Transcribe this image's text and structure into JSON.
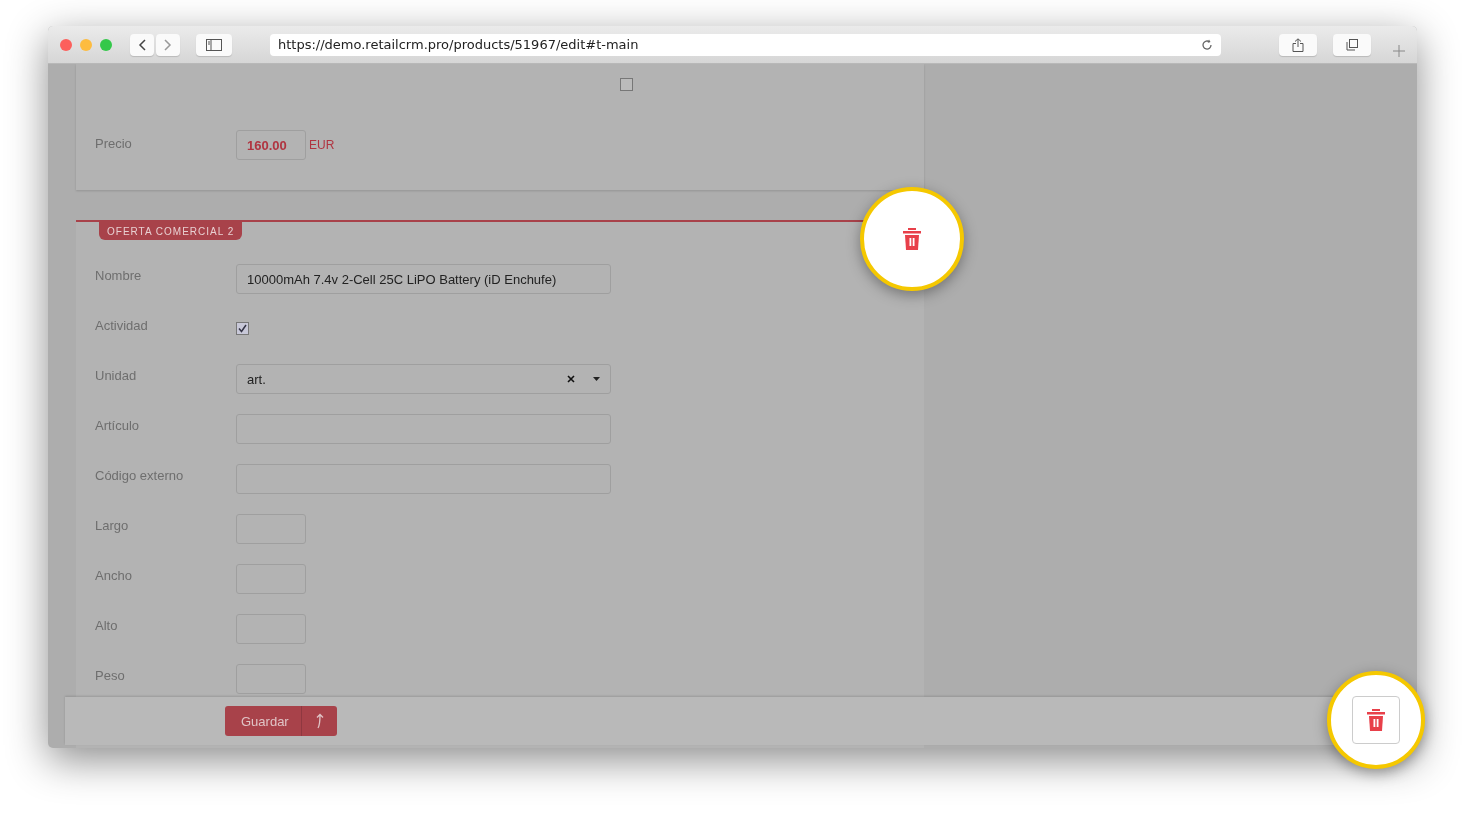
{
  "browser": {
    "url": "https://demo.retailcrm.pro/products/51967/edit#t-main"
  },
  "top_checkbox": {
    "checked": false
  },
  "price": {
    "label": "Precio",
    "value": "160.00",
    "currency": "EUR"
  },
  "offer": {
    "title": "OFERTA COMERCIAL 2",
    "fields": [
      {
        "kind": "text",
        "label": "Nombre",
        "value": "10000mAh 7.4v 2-Cell 25C LiPO Battery (iD Enchufe)"
      },
      {
        "kind": "checkbox",
        "label": "Actividad",
        "checked": true
      },
      {
        "kind": "select",
        "label": "Unidad",
        "value": "art."
      },
      {
        "kind": "text",
        "label": "Artículo"
      },
      {
        "kind": "text",
        "label": "Código externo"
      },
      {
        "kind": "short",
        "label": "Largo"
      },
      {
        "kind": "short",
        "label": "Ancho"
      },
      {
        "kind": "short",
        "label": "Alto"
      },
      {
        "kind": "short",
        "label": "Peso"
      }
    ]
  },
  "footer": {
    "save_label": "Guardar"
  }
}
